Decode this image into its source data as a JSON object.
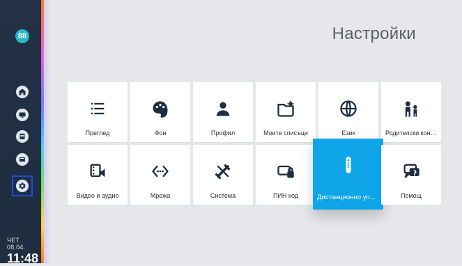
{
  "header": {
    "title": "Настройки"
  },
  "sidebar": {
    "profile_badge_text": "88",
    "items": [
      {
        "icon": "home-icon"
      },
      {
        "icon": "tv-icon"
      },
      {
        "icon": "recordings-icon"
      },
      {
        "icon": "library-icon"
      },
      {
        "icon": "settings-icon"
      }
    ],
    "date": "ЧЕТ 08.04.",
    "time": "11:48"
  },
  "settings_tiles": [
    {
      "label": "Преглед",
      "icon": "list-icon"
    },
    {
      "label": "Фон",
      "icon": "palette-icon"
    },
    {
      "label": "Профил",
      "icon": "user-icon"
    },
    {
      "label": "Моите списъци",
      "icon": "folder-gear-icon"
    },
    {
      "label": "Език",
      "icon": "globe-icon"
    },
    {
      "label": "Родителски конт…",
      "icon": "parental-icon"
    },
    {
      "label": "Видео и аудио",
      "icon": "video-audio-icon"
    },
    {
      "label": "Мрежа",
      "icon": "network-icon"
    },
    {
      "label": "Система",
      "icon": "tools-icon"
    },
    {
      "label": "ПИН код",
      "icon": "pin-lock-icon"
    },
    {
      "label": "Дистанционно уп...",
      "icon": "remote-icon"
    },
    {
      "label": "Помощ",
      "icon": "help-icon"
    }
  ],
  "colors": {
    "focus_tile": "#0ea5e9",
    "sidebar_bg": "#223146",
    "focus_outline": "#1c4fe0"
  }
}
